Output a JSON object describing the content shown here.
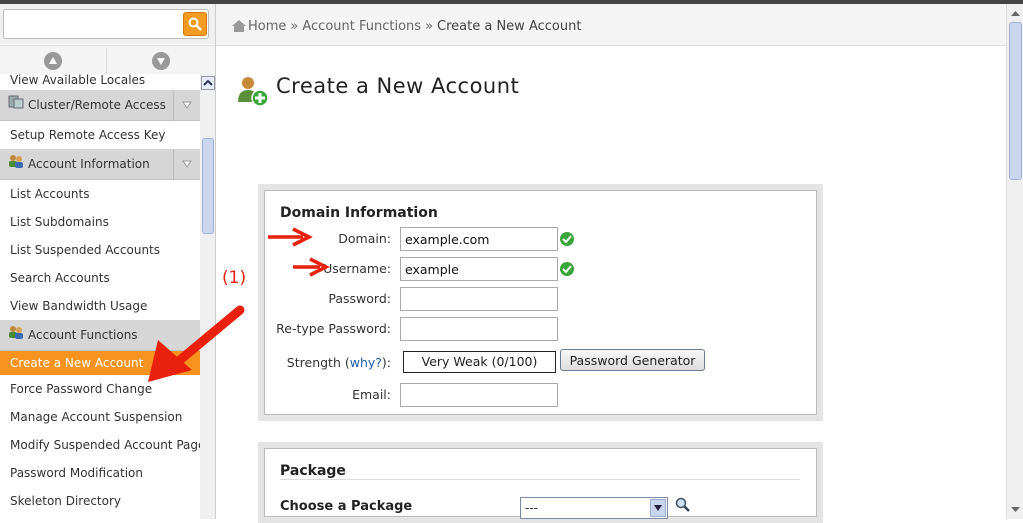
{
  "search": {
    "value": "",
    "placeholder": ""
  },
  "sidebar": {
    "items_top": [
      {
        "label": "View Available Locales"
      }
    ],
    "cluster_header": "Cluster/Remote Access",
    "cluster_items": [
      {
        "label": "Setup Remote Access Key"
      }
    ],
    "account_info_header": "Account Information",
    "account_info_items": [
      {
        "label": "List Accounts"
      },
      {
        "label": "List Subdomains"
      },
      {
        "label": "List Suspended Accounts"
      },
      {
        "label": "Search Accounts"
      },
      {
        "label": "View Bandwidth Usage"
      }
    ],
    "account_functions_header": "Account Functions",
    "account_functions_items": [
      {
        "label": "Create a New Account"
      },
      {
        "label": "Force Password Change"
      },
      {
        "label": "Manage Account Suspension"
      },
      {
        "label": "Modify Suspended Account Page"
      },
      {
        "label": "Password Modification"
      },
      {
        "label": "Skeleton Directory"
      }
    ]
  },
  "breadcrumb": {
    "home": "Home",
    "section": "Account Functions",
    "current": "Create a New Account",
    "separator": "»"
  },
  "page": {
    "title": "Create a New Account"
  },
  "domain_info": {
    "title": "Domain Information",
    "domain_label": "Domain:",
    "domain_value": "example.com",
    "username_label": "Username:",
    "username_value": "example",
    "password_label": "Password:",
    "password_value": "",
    "retype_label": "Re-type Password:",
    "retype_value": "",
    "strength_label": "Strength (",
    "strength_why": "why?",
    "strength_close": "):",
    "strength_value": "Very Weak (0/100)",
    "generator_button": "Password Generator",
    "email_label": "Email:",
    "email_value": ""
  },
  "package": {
    "title": "Package",
    "choose_label": "Choose a Package",
    "selected": "---"
  },
  "annotation": {
    "label": "(1)"
  },
  "colors": {
    "accent": "#f7931e",
    "annotation": "#e8200c",
    "check": "#3aa53a"
  }
}
